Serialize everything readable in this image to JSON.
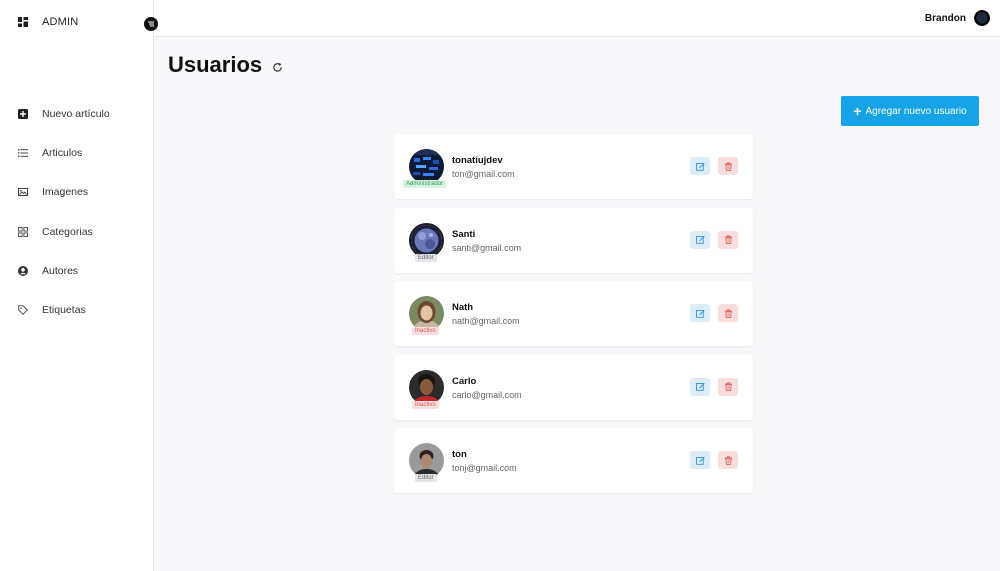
{
  "sidebar": {
    "brand": "ADMIN",
    "items": [
      {
        "label": "Nuevo artículo",
        "icon": "plus-square-icon"
      },
      {
        "label": "Articulos",
        "icon": "list-icon"
      },
      {
        "label": "Imagenes",
        "icon": "image-icon"
      },
      {
        "label": "Categorias",
        "icon": "grid-icon"
      },
      {
        "label": "Autores",
        "icon": "user-circle-icon"
      },
      {
        "label": "Etiquetas",
        "icon": "tag-icon"
      }
    ]
  },
  "topbar": {
    "user_name": "Brandon"
  },
  "main": {
    "title": "Usuarios",
    "add_button": "Agregar nuevo usuario",
    "users": [
      {
        "name": "tonatiujdev",
        "email": "ton@gmail.com",
        "role": "Administrador",
        "role_color": "#2e9e57",
        "role_bg": "#d9f3e2"
      },
      {
        "name": "Santi",
        "email": "santi@gmail.com",
        "role": "Editor",
        "role_color": "#666666",
        "role_bg": "#e4e5e8"
      },
      {
        "name": "Nath",
        "email": "nath@gmail.com",
        "role": "Inactivo",
        "role_color": "#d9534f",
        "role_bg": "#fbdede"
      },
      {
        "name": "Carlo",
        "email": "carlo@gmail.com",
        "role": "Inactivo",
        "role_color": "#d9534f",
        "role_bg": "#fbdede"
      },
      {
        "name": "ton",
        "email": "tonj@gmail.com",
        "role": "Editor",
        "role_color": "#666666",
        "role_bg": "#e4e5e8"
      }
    ]
  },
  "colors": {
    "accent": "#16a4e6",
    "edit": "#1e88d6",
    "delete": "#e25a5a"
  }
}
